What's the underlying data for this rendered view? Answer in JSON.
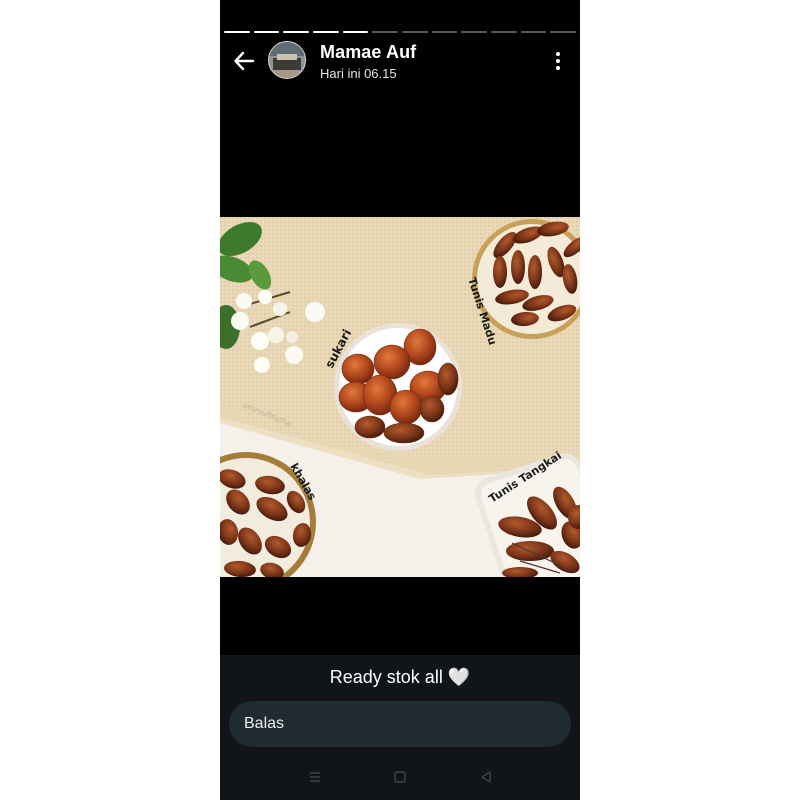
{
  "story": {
    "progress": {
      "total_segments": 12,
      "completed_segments": 5
    },
    "header": {
      "username": "Mamae Auf",
      "timestamp": "Hari ini 06.15"
    },
    "photo": {
      "labels": {
        "sukari": "sukari",
        "tunis_madu": "Tunis Madu",
        "khalas": "khalas",
        "tunis_tangkai": "Tunis Tangkai",
        "watermark": "ummufiruma"
      }
    },
    "caption": "Ready stok all 🤍",
    "reply": {
      "label": "Balas"
    }
  },
  "colors": {
    "background": "#000000",
    "caption_bar": "#111519",
    "reply_pill": "#1f2a31",
    "progress_active": "#ffffff",
    "progress_inactive": "#5a5a5a"
  },
  "icons": {
    "back": "arrow-left-icon",
    "more": "more-vertical-icon",
    "nav_menu": "recents-icon",
    "nav_home": "home-icon",
    "nav_back": "back-triangle-icon"
  }
}
